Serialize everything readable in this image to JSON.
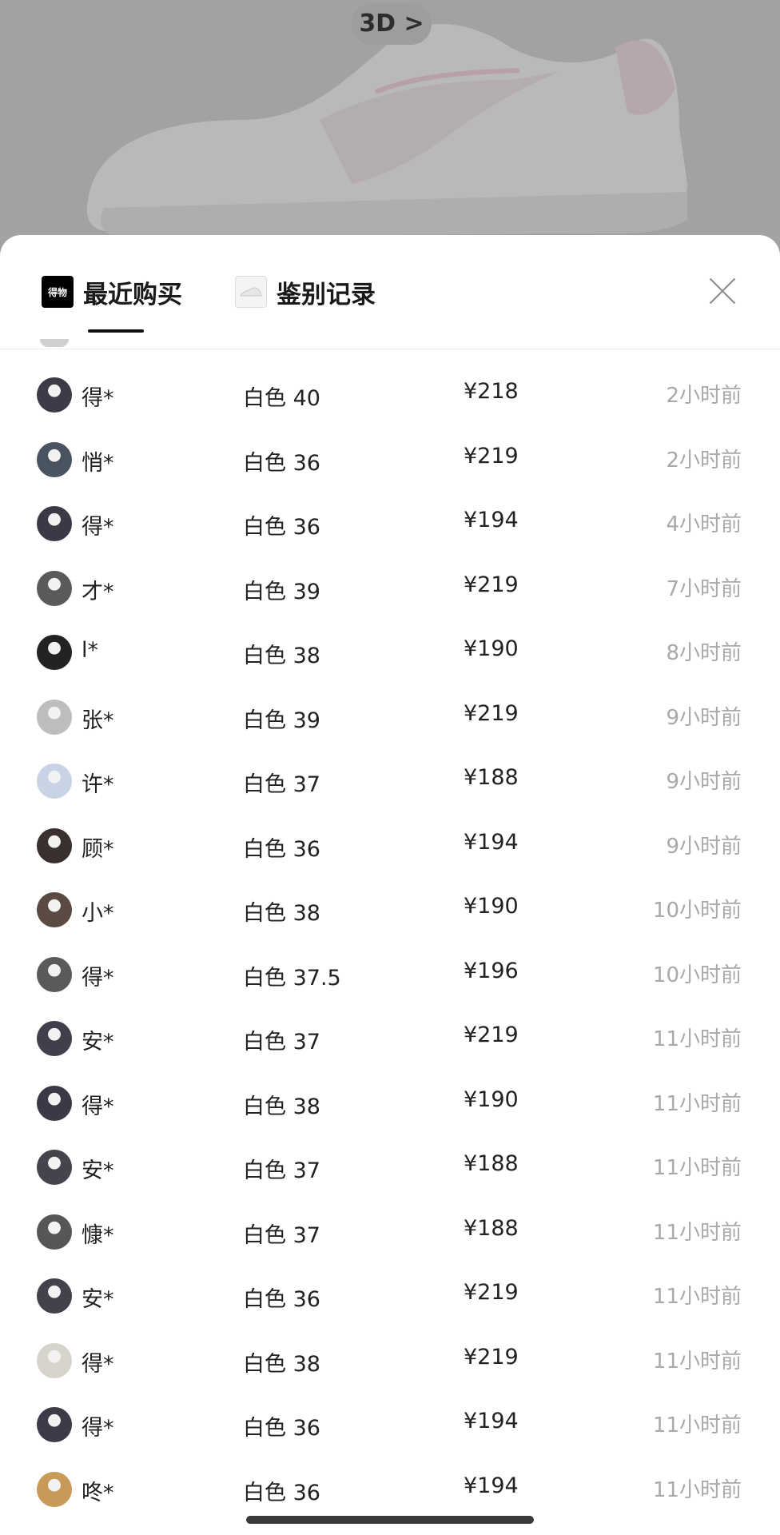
{
  "hero": {
    "button_3d": "3D >"
  },
  "tabs": [
    {
      "label": "最近购买",
      "icon": "dewu-logo-icon",
      "icon_text": "得物",
      "active": true
    },
    {
      "label": "鉴别记录",
      "icon": "shoe-thumb-icon",
      "active": false
    }
  ],
  "colors": {
    "sheet": "#ffffff",
    "text": "#222222",
    "muted": "#a9a9a9",
    "overlay": "#9a9a9a"
  },
  "rows": [
    {
      "name": "得*",
      "spec": "白色 40",
      "price": "¥218",
      "time": "2小时前",
      "avatar_color": "#3c3c48"
    },
    {
      "name": "悄*",
      "spec": "白色 36",
      "price": "¥219",
      "time": "2小时前",
      "avatar_color": "#4a5360"
    },
    {
      "name": "得*",
      "spec": "白色 36",
      "price": "¥194",
      "time": "4小时前",
      "avatar_color": "#3a3a46"
    },
    {
      "name": "才*",
      "spec": "白色 39",
      "price": "¥219",
      "time": "7小时前",
      "avatar_color": "#5a5a5a"
    },
    {
      "name": "l*",
      "spec": "白色 38",
      "price": "¥190",
      "time": "8小时前",
      "avatar_color": "#222222"
    },
    {
      "name": "张*",
      "spec": "白色 39",
      "price": "¥219",
      "time": "9小时前",
      "avatar_color": "#bdbdbd"
    },
    {
      "name": "许*",
      "spec": "白色 37",
      "price": "¥188",
      "time": "9小时前",
      "avatar_color": "#c9d3e6"
    },
    {
      "name": "顾*",
      "spec": "白色 36",
      "price": "¥194",
      "time": "9小时前",
      "avatar_color": "#3a3030"
    },
    {
      "name": "小*",
      "spec": "白色 38",
      "price": "¥190",
      "time": "10小时前",
      "avatar_color": "#5b4a42"
    },
    {
      "name": "得*",
      "spec": "白色 37.5",
      "price": "¥196",
      "time": "10小时前",
      "avatar_color": "#5a5a5a"
    },
    {
      "name": "安*",
      "spec": "白色 37",
      "price": "¥219",
      "time": "11小时前",
      "avatar_color": "#40404c"
    },
    {
      "name": "得*",
      "spec": "白色 38",
      "price": "¥190",
      "time": "11小时前",
      "avatar_color": "#3a3a46"
    },
    {
      "name": "安*",
      "spec": "白色 37",
      "price": "¥188",
      "time": "11小时前",
      "avatar_color": "#44444e"
    },
    {
      "name": "慷*",
      "spec": "白色 37",
      "price": "¥188",
      "time": "11小时前",
      "avatar_color": "#565656"
    },
    {
      "name": "安*",
      "spec": "白色 36",
      "price": "¥219",
      "time": "11小时前",
      "avatar_color": "#42424c"
    },
    {
      "name": "得*",
      "spec": "白色 38",
      "price": "¥219",
      "time": "11小时前",
      "avatar_color": "#d8d4cc"
    },
    {
      "name": "得*",
      "spec": "白色 36",
      "price": "¥194",
      "time": "11小时前",
      "avatar_color": "#3c3c48"
    },
    {
      "name": "咚*",
      "spec": "白色 36",
      "price": "¥194",
      "time": "11小时前",
      "avatar_color": "#c89a58"
    }
  ]
}
